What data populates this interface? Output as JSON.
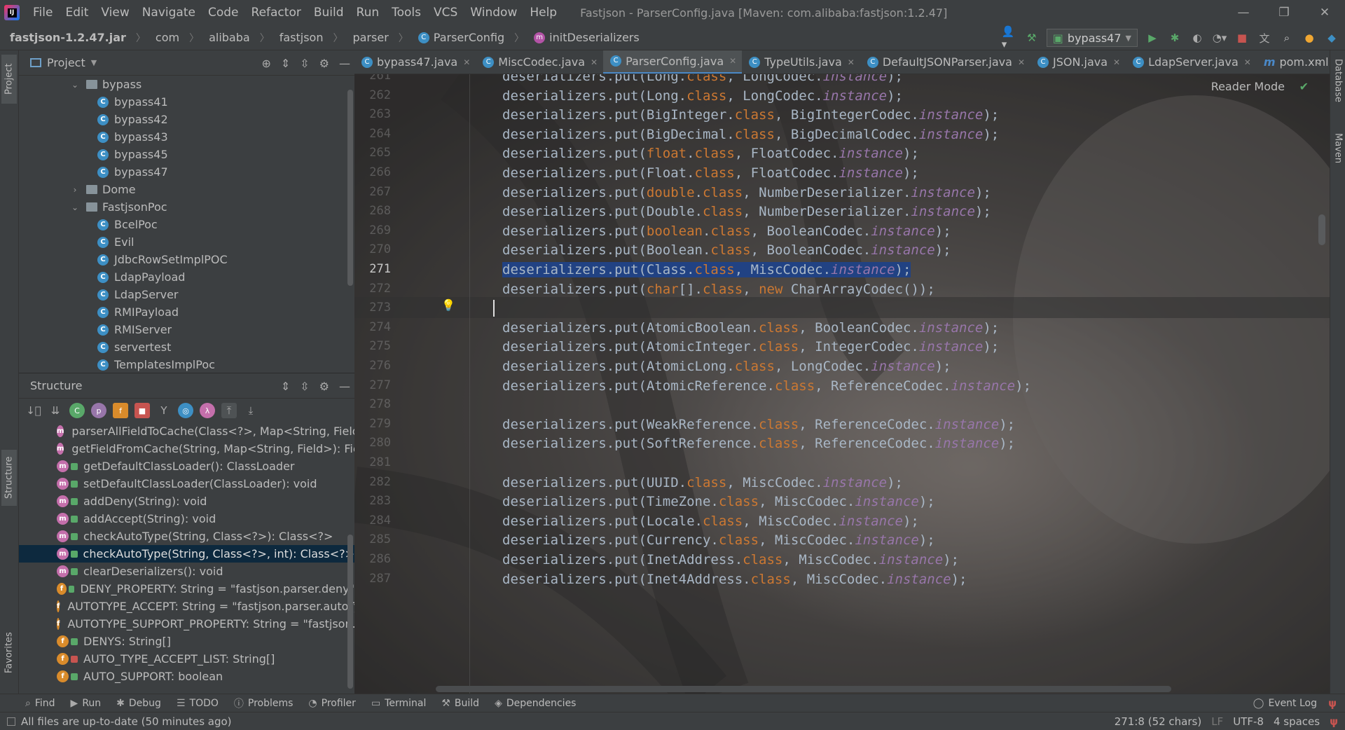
{
  "menu": {
    "items": [
      "File",
      "Edit",
      "View",
      "Navigate",
      "Code",
      "Refactor",
      "Build",
      "Run",
      "Tools",
      "VCS",
      "Window",
      "Help"
    ],
    "window_title": "Fastjson - ParserConfig.java [Maven: com.alibaba:fastjson:1.2.47]"
  },
  "breadcrumb": {
    "jar": "fastjson-1.2.47.jar",
    "parts": [
      "com",
      "alibaba",
      "fastjson",
      "parser"
    ],
    "class": "ParserConfig",
    "method": "initDeserializers"
  },
  "run_config": {
    "name": "bypass47"
  },
  "project_panel": {
    "title": "Project",
    "rows": [
      {
        "label": "bypass",
        "kind": "folder",
        "expanded": true,
        "depth": 1
      },
      {
        "label": "bypass41",
        "kind": "class",
        "depth": 2
      },
      {
        "label": "bypass42",
        "kind": "class",
        "depth": 2
      },
      {
        "label": "bypass43",
        "kind": "class",
        "depth": 2
      },
      {
        "label": "bypass45",
        "kind": "class",
        "depth": 2
      },
      {
        "label": "bypass47",
        "kind": "class",
        "depth": 2
      },
      {
        "label": "Dome",
        "kind": "folder",
        "expanded": false,
        "depth": 1
      },
      {
        "label": "FastjsonPoc",
        "kind": "folder",
        "expanded": true,
        "depth": 1
      },
      {
        "label": "BcelPoc",
        "kind": "class",
        "depth": 2
      },
      {
        "label": "Evil",
        "kind": "class",
        "depth": 2
      },
      {
        "label": "JdbcRowSetImplPOC",
        "kind": "class",
        "depth": 2
      },
      {
        "label": "LdapPayload",
        "kind": "class",
        "depth": 2
      },
      {
        "label": "LdapServer",
        "kind": "class",
        "depth": 2
      },
      {
        "label": "RMIPayload",
        "kind": "class",
        "depth": 2
      },
      {
        "label": "RMIServer",
        "kind": "class",
        "depth": 2
      },
      {
        "label": "servertest",
        "kind": "class",
        "depth": 2
      },
      {
        "label": "TemplatesImplPoc",
        "kind": "class",
        "depth": 2
      }
    ]
  },
  "structure_panel": {
    "title": "Structure",
    "rows": [
      {
        "badge": "m",
        "vis": "pub",
        "label": "parserAllFieldToCache(Class<?>, Map<String, Field>"
      },
      {
        "badge": "m",
        "vis": "pub",
        "label": "getFieldFromCache(String, Map<String, Field>): Field"
      },
      {
        "badge": "m",
        "vis": "pub",
        "label": "getDefaultClassLoader(): ClassLoader"
      },
      {
        "badge": "m",
        "vis": "pub",
        "label": "setDefaultClassLoader(ClassLoader): void"
      },
      {
        "badge": "m",
        "vis": "pub",
        "label": "addDeny(String): void"
      },
      {
        "badge": "m",
        "vis": "pub",
        "label": "addAccept(String): void"
      },
      {
        "badge": "m",
        "vis": "pub",
        "label": "checkAutoType(String, Class<?>): Class<?>"
      },
      {
        "badge": "m",
        "vis": "pub",
        "label": "checkAutoType(String, Class<?>, int): Class<?>",
        "selected": true
      },
      {
        "badge": "m",
        "vis": "pub",
        "label": "clearDeserializers(): void"
      },
      {
        "badge": "f",
        "vis": "pub",
        "label": "DENY_PROPERTY: String = \"fastjson.parser.deny\""
      },
      {
        "badge": "f",
        "vis": "pub",
        "label": "AUTOTYPE_ACCEPT: String = \"fastjson.parser.autoTy"
      },
      {
        "badge": "f",
        "vis": "pub",
        "label": "AUTOTYPE_SUPPORT_PROPERTY: String = \"fastjson.p"
      },
      {
        "badge": "f",
        "vis": "pub",
        "label": "DENYS: String[]"
      },
      {
        "badge": "f",
        "vis": "priv",
        "label": "AUTO_TYPE_ACCEPT_LIST: String[]"
      },
      {
        "badge": "f",
        "vis": "pub",
        "label": "AUTO_SUPPORT: boolean"
      }
    ]
  },
  "editor_tabs": [
    {
      "label": "bypass47.java",
      "icon": "class"
    },
    {
      "label": "MiscCodec.java",
      "icon": "class"
    },
    {
      "label": "ParserConfig.java",
      "icon": "class",
      "active": true
    },
    {
      "label": "TypeUtils.java",
      "icon": "class"
    },
    {
      "label": "DefaultJSONParser.java",
      "icon": "class"
    },
    {
      "label": "JSON.java",
      "icon": "class"
    },
    {
      "label": "LdapServer.java",
      "icon": "class"
    },
    {
      "label": "pom.xml (F",
      "icon": "maven"
    }
  ],
  "reader_mode": "Reader Mode",
  "code": {
    "current_line": 271,
    "lines": [
      {
        "n": "261",
        "t": [
          [
            "deserializers.put(Long.",
            "d"
          ],
          [
            "class",
            "k"
          ],
          [
            ", LongCodec.",
            "d"
          ],
          [
            "instance",
            "i"
          ],
          [
            ");",
            "d"
          ]
        ]
      },
      {
        "n": "262",
        "t": [
          [
            "deserializers.put(Long.",
            "d"
          ],
          [
            "class",
            "k"
          ],
          [
            ", LongCodec.",
            "d"
          ],
          [
            "instance",
            "i"
          ],
          [
            ");",
            "d"
          ]
        ]
      },
      {
        "n": "263",
        "t": [
          [
            "deserializers.put(BigInteger.",
            "d"
          ],
          [
            "class",
            "k"
          ],
          [
            ", BigIntegerCodec.",
            "d"
          ],
          [
            "instance",
            "i"
          ],
          [
            ");",
            "d"
          ]
        ]
      },
      {
        "n": "264",
        "t": [
          [
            "deserializers.put(BigDecimal.",
            "d"
          ],
          [
            "class",
            "k"
          ],
          [
            ", BigDecimalCodec.",
            "d"
          ],
          [
            "instance",
            "i"
          ],
          [
            ");",
            "d"
          ]
        ]
      },
      {
        "n": "265",
        "t": [
          [
            "deserializers.put(",
            "d"
          ],
          [
            "float",
            "k"
          ],
          [
            ".",
            "d"
          ],
          [
            "class",
            "k"
          ],
          [
            ", FloatCodec.",
            "d"
          ],
          [
            "instance",
            "i"
          ],
          [
            ");",
            "d"
          ]
        ]
      },
      {
        "n": "266",
        "t": [
          [
            "deserializers.put(Float.",
            "d"
          ],
          [
            "class",
            "k"
          ],
          [
            ", FloatCodec.",
            "d"
          ],
          [
            "instance",
            "i"
          ],
          [
            ");",
            "d"
          ]
        ]
      },
      {
        "n": "267",
        "t": [
          [
            "deserializers.put(",
            "d"
          ],
          [
            "double",
            "k"
          ],
          [
            ".",
            "d"
          ],
          [
            "class",
            "k"
          ],
          [
            ", NumberDeserializer.",
            "d"
          ],
          [
            "instance",
            "i"
          ],
          [
            ");",
            "d"
          ]
        ]
      },
      {
        "n": "268",
        "t": [
          [
            "deserializers.put(Double.",
            "d"
          ],
          [
            "class",
            "k"
          ],
          [
            ", NumberDeserializer.",
            "d"
          ],
          [
            "instance",
            "i"
          ],
          [
            ");",
            "d"
          ]
        ]
      },
      {
        "n": "269",
        "t": [
          [
            "deserializers.put(",
            "d"
          ],
          [
            "boolean",
            "k"
          ],
          [
            ".",
            "d"
          ],
          [
            "class",
            "k"
          ],
          [
            ", BooleanCodec.",
            "d"
          ],
          [
            "instance",
            "i"
          ],
          [
            ");",
            "d"
          ]
        ]
      },
      {
        "n": "270",
        "t": [
          [
            "deserializers.put(Boolean.",
            "d"
          ],
          [
            "class",
            "k"
          ],
          [
            ", BooleanCodec.",
            "d"
          ],
          [
            "instance",
            "i"
          ],
          [
            ");",
            "d"
          ]
        ]
      },
      {
        "n": "271",
        "sel": true,
        "t": [
          [
            "deserializers.put(Class.",
            "d"
          ],
          [
            "class",
            "k"
          ],
          [
            ", MiscCodec.",
            "d"
          ],
          [
            "instance",
            "i"
          ],
          [
            ");",
            "d"
          ]
        ]
      },
      {
        "n": "272",
        "t": [
          [
            "deserializers.put(",
            "d"
          ],
          [
            "char",
            "k"
          ],
          [
            "[].",
            "d"
          ],
          [
            "class",
            "k"
          ],
          [
            ", ",
            "d"
          ],
          [
            "new",
            "k"
          ],
          [
            " CharArrayCodec());",
            "d"
          ]
        ]
      },
      {
        "n": "273",
        "t": []
      },
      {
        "n": "274",
        "t": [
          [
            "deserializers.put(AtomicBoolean.",
            "d"
          ],
          [
            "class",
            "k"
          ],
          [
            ", BooleanCodec.",
            "d"
          ],
          [
            "instance",
            "i"
          ],
          [
            ");",
            "d"
          ]
        ]
      },
      {
        "n": "275",
        "t": [
          [
            "deserializers.put(AtomicInteger.",
            "d"
          ],
          [
            "class",
            "k"
          ],
          [
            ", IntegerCodec.",
            "d"
          ],
          [
            "instance",
            "i"
          ],
          [
            ");",
            "d"
          ]
        ]
      },
      {
        "n": "276",
        "t": [
          [
            "deserializers.put(AtomicLong.",
            "d"
          ],
          [
            "class",
            "k"
          ],
          [
            ", LongCodec.",
            "d"
          ],
          [
            "instance",
            "i"
          ],
          [
            ");",
            "d"
          ]
        ]
      },
      {
        "n": "277",
        "t": [
          [
            "deserializers.put(AtomicReference.",
            "d"
          ],
          [
            "class",
            "k"
          ],
          [
            ", ReferenceCodec.",
            "d"
          ],
          [
            "instance",
            "i"
          ],
          [
            ");",
            "d"
          ]
        ]
      },
      {
        "n": "278",
        "t": []
      },
      {
        "n": "279",
        "t": [
          [
            "deserializers.put(WeakReference.",
            "d"
          ],
          [
            "class",
            "k"
          ],
          [
            ", ReferenceCodec.",
            "d"
          ],
          [
            "instance",
            "i"
          ],
          [
            ");",
            "d"
          ]
        ]
      },
      {
        "n": "280",
        "t": [
          [
            "deserializers.put(SoftReference.",
            "d"
          ],
          [
            "class",
            "k"
          ],
          [
            ", ReferenceCodec.",
            "d"
          ],
          [
            "instance",
            "i"
          ],
          [
            ");",
            "d"
          ]
        ]
      },
      {
        "n": "281",
        "t": []
      },
      {
        "n": "282",
        "t": [
          [
            "deserializers.put(UUID.",
            "d"
          ],
          [
            "class",
            "k"
          ],
          [
            ", MiscCodec.",
            "d"
          ],
          [
            "instance",
            "i"
          ],
          [
            ");",
            "d"
          ]
        ]
      },
      {
        "n": "283",
        "t": [
          [
            "deserializers.put(TimeZone.",
            "d"
          ],
          [
            "class",
            "k"
          ],
          [
            ", MiscCodec.",
            "d"
          ],
          [
            "instance",
            "i"
          ],
          [
            ");",
            "d"
          ]
        ]
      },
      {
        "n": "284",
        "t": [
          [
            "deserializers.put(Locale.",
            "d"
          ],
          [
            "class",
            "k"
          ],
          [
            ", MiscCodec.",
            "d"
          ],
          [
            "instance",
            "i"
          ],
          [
            ");",
            "d"
          ]
        ]
      },
      {
        "n": "285",
        "t": [
          [
            "deserializers.put(Currency.",
            "d"
          ],
          [
            "class",
            "k"
          ],
          [
            ", MiscCodec.",
            "d"
          ],
          [
            "instance",
            "i"
          ],
          [
            ");",
            "d"
          ]
        ]
      },
      {
        "n": "286",
        "t": [
          [
            "deserializers.put(InetAddress.",
            "d"
          ],
          [
            "class",
            "k"
          ],
          [
            ", MiscCodec.",
            "d"
          ],
          [
            "instance",
            "i"
          ],
          [
            ");",
            "d"
          ]
        ]
      },
      {
        "n": "287",
        "t": [
          [
            "deserializers.put(Inet4Address.",
            "d"
          ],
          [
            "class",
            "k"
          ],
          [
            ", MiscCodec.",
            "d"
          ],
          [
            "instance",
            "i"
          ],
          [
            ");",
            "d"
          ]
        ]
      }
    ]
  },
  "right_strip": {
    "database": "Database",
    "maven": "Maven"
  },
  "left_strip": {
    "project": "Project",
    "structure": "Structure",
    "favorites": "Favorites"
  },
  "tool_windows": [
    "Find",
    "Run",
    "Debug",
    "TODO",
    "Problems",
    "Profiler",
    "Terminal",
    "Build",
    "Dependencies"
  ],
  "event_log": "Event Log",
  "status": {
    "message": "All files are up-to-date (50 minutes ago)",
    "position": "271:8 (52 chars)",
    "line_sep": "LF",
    "encoding": "UTF-8",
    "indent": "4 spaces"
  }
}
